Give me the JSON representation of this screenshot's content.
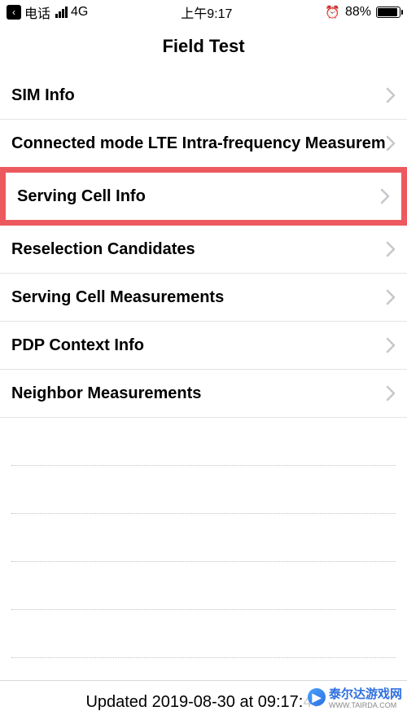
{
  "statusBar": {
    "backGlyph": "‹",
    "carrier": "电话",
    "network": "4G",
    "time": "上午9:17",
    "alarmGlyph": "⏰",
    "batteryPercent": "88%"
  },
  "nav": {
    "title": "Field Test"
  },
  "menu": {
    "items": [
      {
        "label": "SIM Info",
        "highlighted": false
      },
      {
        "label": "Connected mode LTE Intra-frequency Measurement",
        "highlighted": false
      },
      {
        "label": "Serving Cell Info",
        "highlighted": true
      },
      {
        "label": "Reselection Candidates",
        "highlighted": false
      },
      {
        "label": "Serving Cell Measurements",
        "highlighted": false
      },
      {
        "label": "PDP Context Info",
        "highlighted": false
      },
      {
        "label": "Neighbor Measurements",
        "highlighted": false
      }
    ]
  },
  "footer": {
    "updatedText": "Updated 2019-08-30 at 09:17:47"
  },
  "watermark": {
    "text": "泰尔达游戏网",
    "sub": "WWW.TAIRDA.COM",
    "iconGlyph": "▶"
  }
}
